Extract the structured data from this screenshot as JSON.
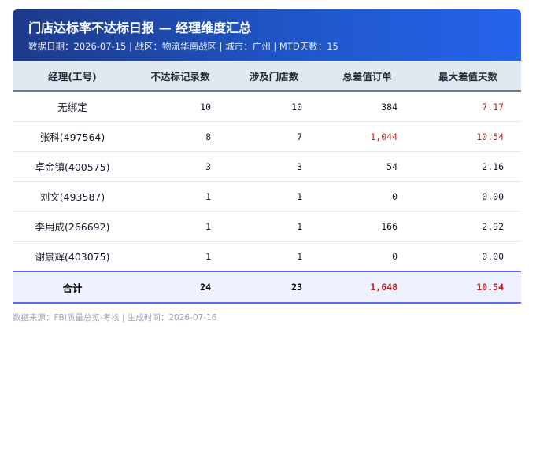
{
  "header": {
    "title": "门店达标率不达标日报 — 经理维度汇总",
    "meta": "数据日期：2026-07-15 | 战区：物流华南战区 | 城市：广州 | MTD天数：15"
  },
  "table": {
    "columns": [
      "经理(工号)",
      "不达标记录数",
      "涉及门店数",
      "总差值订单",
      "最大差值天数"
    ],
    "rows": [
      {
        "manager": "无绑定",
        "records": "10",
        "stores": "10",
        "total_diff_orders": "384",
        "max_diff_days": "7.17"
      },
      {
        "manager": "张科(497564)",
        "records": "8",
        "stores": "7",
        "total_diff_orders": "1,044",
        "max_diff_days": "10.54"
      },
      {
        "manager": "卓金镇(400575)",
        "records": "3",
        "stores": "3",
        "total_diff_orders": "54",
        "max_diff_days": "2.16"
      },
      {
        "manager": "刘文(493587)",
        "records": "1",
        "stores": "1",
        "total_diff_orders": "0",
        "max_diff_days": "0.00"
      },
      {
        "manager": "李用成(266692)",
        "records": "1",
        "stores": "1",
        "total_diff_orders": "166",
        "max_diff_days": "2.92"
      },
      {
        "manager": "谢景辉(403075)",
        "records": "1",
        "stores": "1",
        "total_diff_orders": "0",
        "max_diff_days": "0.00"
      }
    ],
    "total": {
      "label": "合计",
      "records": "24",
      "stores": "23",
      "total_diff_orders": "1,648",
      "max_diff_days": "10.54"
    }
  },
  "footer": {
    "text": "数据来源：FBI质量总览-考核 | 生成时间：2026-07-16"
  },
  "colors": {
    "header_start": "#1e3a8a",
    "header_end": "#2563eb",
    "highlight_red": "#c81e1e",
    "total_border": "#6366f1"
  }
}
